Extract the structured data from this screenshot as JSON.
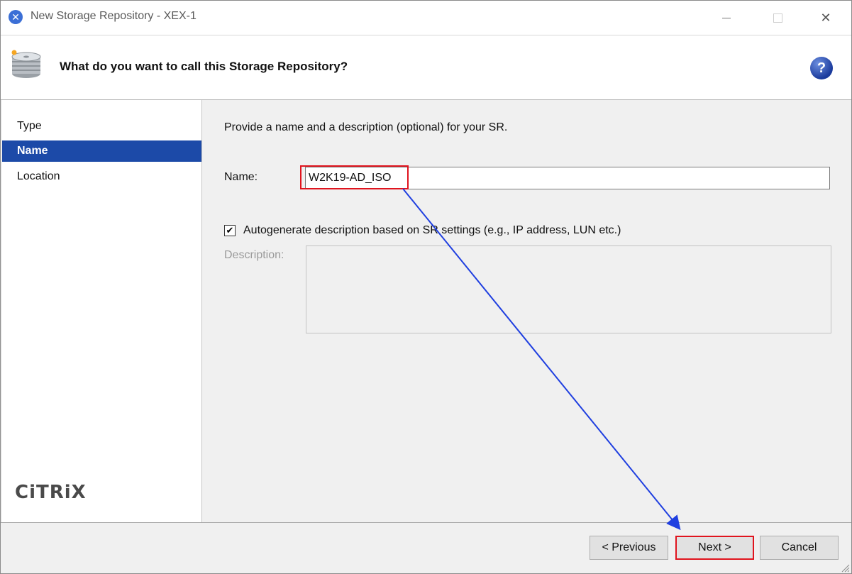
{
  "window": {
    "title": "New Storage Repository - XEX-1",
    "controls": {
      "minimize": "—",
      "maximize": "□",
      "close": "✕"
    }
  },
  "header": {
    "title": "What do you want to call this Storage Repository?",
    "help": "?"
  },
  "nav": {
    "items": [
      {
        "label": "Type",
        "active": false
      },
      {
        "label": "Name",
        "active": true
      },
      {
        "label": "Location",
        "active": false
      }
    ],
    "logo": "CiTRiX"
  },
  "main": {
    "intro": "Provide a name and a description (optional) for your SR.",
    "name_label": "Name:",
    "name_value": "W2K19-AD_ISO",
    "autogen_checked": true,
    "autogen_label": "Autogenerate description based on SR settings (e.g., IP address, LUN etc.)",
    "description_label": "Description:",
    "description_value": ""
  },
  "footer": {
    "previous": "< Previous",
    "next": "Next >",
    "cancel": "Cancel"
  },
  "colors": {
    "accent": "#1c4aa8",
    "highlight": "#e0141e",
    "arrow": "#1f3fe0"
  }
}
